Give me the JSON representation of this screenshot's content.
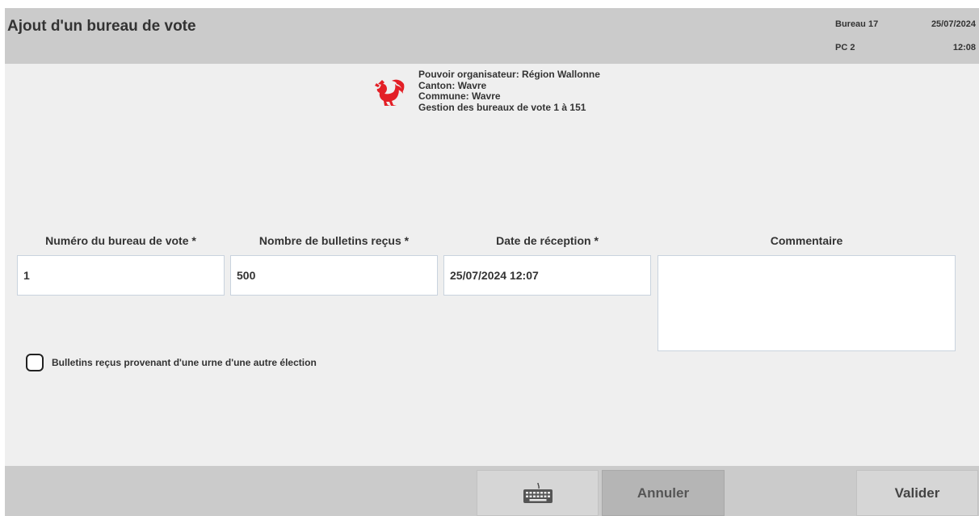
{
  "header": {
    "title": "Ajout d'un bureau de vote",
    "bureau": "Bureau 17",
    "date": "25/07/2024",
    "pc": "PC 2",
    "time": "12:08"
  },
  "organisation": {
    "logo_icon": "wallonia-rooster-icon",
    "lines": [
      "Pouvoir organisateur: Région Wallonne",
      "Canton: Wavre",
      "Commune: Wavre",
      "Gestion des bureaux de vote 1 à 151"
    ]
  },
  "form": {
    "bureau_number": {
      "label": "Numéro du bureau de vote *",
      "value": "1"
    },
    "ballots_received": {
      "label": "Nombre de bulletins reçus *",
      "value": "500"
    },
    "reception_date": {
      "label": "Date de réception *",
      "value": "25/07/2024 12:07"
    },
    "comment": {
      "label": "Commentaire",
      "value": ""
    },
    "other_election_checkbox": {
      "label": "Bulletins reçus provenant d'une urne d'une autre élection",
      "checked": false
    }
  },
  "footer": {
    "keyboard_icon": "keyboard-icon",
    "cancel_label": "Annuler",
    "validate_label": "Valider"
  },
  "colors": {
    "header_bg": "#cbcbcb",
    "page_bg": "#efefef",
    "rooster_red": "#e31f26",
    "cancel_bg": "#b5b5b5"
  }
}
